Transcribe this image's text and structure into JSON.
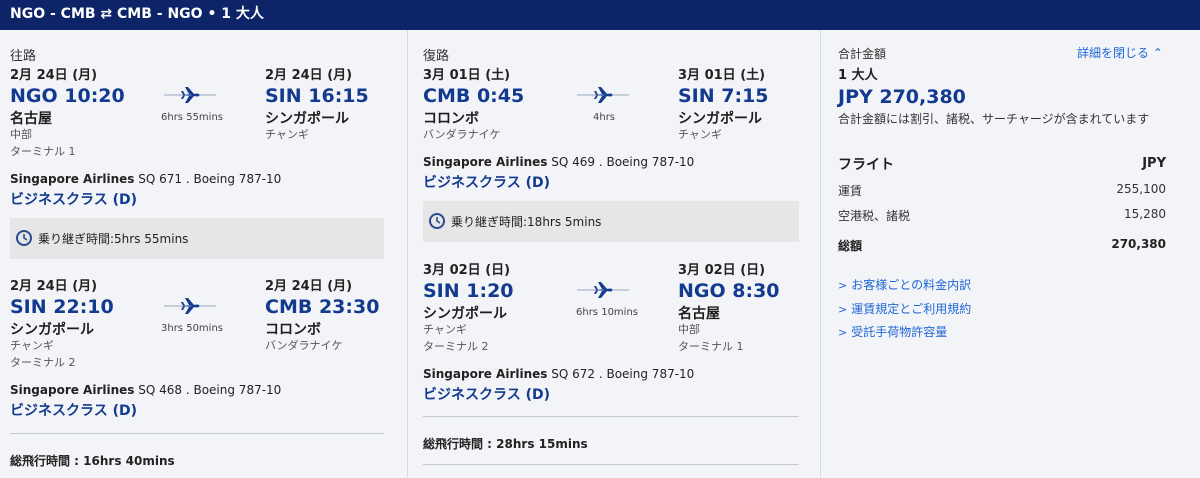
{
  "header": {
    "route": "NGO - CMB ⇄ CMB - NGO  •  1 大人"
  },
  "outbound": {
    "label": "往路",
    "leg1": {
      "dep_date": "2月 24日 (月)",
      "arr_date": "2月 24日 (月)",
      "dep_time": "NGO 10:20",
      "arr_time": "SIN 16:15",
      "dep_city": "名古屋",
      "arr_city": "シンガポール",
      "dep_airport": "中部",
      "arr_airport": "チャンギ",
      "dep_terminal": "ターミナル 1",
      "duration": "6hrs 55mins",
      "airline": "Singapore Airlines",
      "flight_info": " SQ 671 . Boeing 787-10",
      "cabin": "ビジネスクラス (D)"
    },
    "layover": "乗り継ぎ時間:5hrs 55mins",
    "leg2": {
      "dep_date": "2月 24日 (月)",
      "arr_date": "2月 24日 (月)",
      "dep_time": "SIN 22:10",
      "arr_time": "CMB 23:30",
      "dep_city": "シンガポール",
      "arr_city": "コロンボ",
      "dep_airport": "チャンギ",
      "arr_airport": "バンダラナイケ",
      "dep_terminal": "ターミナル 2",
      "duration": "3hrs 50mins",
      "airline": "Singapore Airlines",
      "flight_info": " SQ 468 . Boeing 787-10",
      "cabin": "ビジネスクラス (D)"
    },
    "total": "総飛行時間 : 16hrs 40mins"
  },
  "return": {
    "label": "復路",
    "leg1": {
      "dep_date": "3月 01日 (土)",
      "arr_date": "3月 01日 (土)",
      "dep_time": "CMB 0:45",
      "arr_time": "SIN 7:15",
      "dep_city": "コロンボ",
      "arr_city": "シンガポール",
      "dep_airport": "バンダラナイケ",
      "arr_airport": "チャンギ",
      "duration": "4hrs",
      "airline": "Singapore Airlines",
      "flight_info": " SQ 469 . Boeing 787-10",
      "cabin": "ビジネスクラス (D)"
    },
    "layover": "乗り継ぎ時間:18hrs 5mins",
    "leg2": {
      "dep_date": "3月 02日 (日)",
      "arr_date": "3月 02日 (日)",
      "dep_time": "SIN 1:20",
      "arr_time": "NGO 8:30",
      "dep_city": "シンガポール",
      "arr_city": "名古屋",
      "dep_airport": "チャンギ",
      "arr_airport": "中部",
      "dep_terminal": "ターミナル 2",
      "arr_terminal": "ターミナル 1",
      "duration": "6hrs 10mins",
      "airline": "Singapore Airlines",
      "flight_info": " SQ 672 . Boeing 787-10",
      "cabin": "ビジネスクラス (D)"
    },
    "total": "総飛行時間 : 28hrs 15mins"
  },
  "summary": {
    "label": "合計金額",
    "close_details": "詳細を閉じる",
    "passengers": "1 大人",
    "price": "JPY 270,380",
    "note": "合計金額には割引、諸税、サーチャージが含まれています",
    "flight_header": "フライト",
    "currency": "JPY",
    "rows": [
      {
        "label": "運賃",
        "value": "255,100"
      },
      {
        "label": "空港税、諸税",
        "value": "15,280"
      }
    ],
    "total_label": "総額",
    "total_value": "270,380",
    "links": [
      "お客様ごとの料金内訳",
      "運賃規定とご利用規約",
      "受託手荷物許容量"
    ]
  },
  "colors": {
    "header_bg": "#0d2468",
    "accent": "#123a8f",
    "link": "#1f66d6"
  }
}
